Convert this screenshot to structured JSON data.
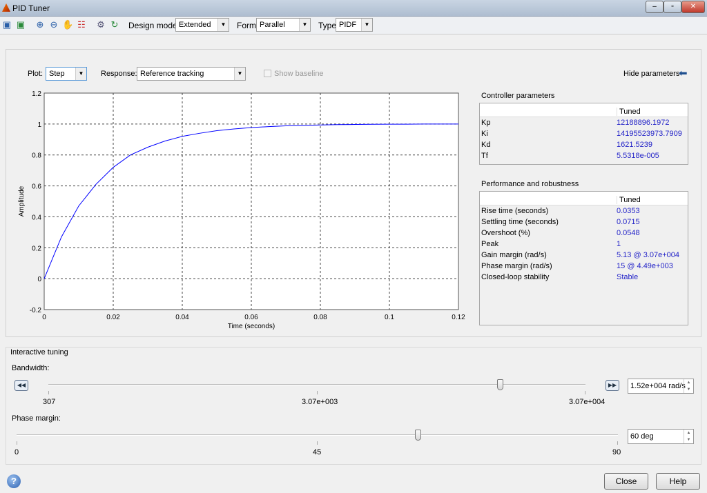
{
  "window": {
    "title": "PID Tuner"
  },
  "toolbar": {
    "icons": [
      "import-plant-icon",
      "export-icon",
      "zoom-in-icon",
      "zoom-out-icon",
      "pan-icon",
      "legend-icon",
      "options-icon",
      "reset-icon"
    ],
    "design_mode_label": "Design mode:",
    "design_mode_value": "Extended",
    "form_label": "Form",
    "form_value": "Parallel",
    "type_label": "Type",
    "type_value": "PIDF"
  },
  "plot_controls": {
    "plot_label": "Plot:",
    "plot_value": "Step",
    "response_label": "Response:",
    "response_value": "Reference tracking",
    "show_baseline": "Show baseline",
    "hide_parameters": "Hide parameters"
  },
  "chart_data": {
    "type": "line",
    "xlabel": "Time (seconds)",
    "ylabel": "Amplitude",
    "xlim": [
      0,
      0.12
    ],
    "ylim": [
      -0.2,
      1.2
    ],
    "grid": true,
    "xticks": [
      "0",
      "0.02",
      "0.04",
      "0.06",
      "0.08",
      "0.1",
      "0.12"
    ],
    "yticks": [
      "-0.2",
      "0",
      "0.2",
      "0.4",
      "0.6",
      "0.8",
      "1",
      "1.2"
    ],
    "series": [
      {
        "color": "#0000ff",
        "x": [
          0,
          0.005,
          0.01,
          0.015,
          0.02,
          0.025,
          0.03,
          0.035,
          0.04,
          0.045,
          0.05,
          0.055,
          0.06,
          0.065,
          0.07,
          0.075,
          0.08,
          0.085,
          0.09,
          0.095,
          0.1,
          0.105,
          0.11,
          0.115,
          0.12
        ],
        "y": [
          0,
          0.27,
          0.47,
          0.61,
          0.72,
          0.8,
          0.85,
          0.89,
          0.92,
          0.94,
          0.957,
          0.968,
          0.977,
          0.983,
          0.988,
          0.991,
          0.994,
          0.996,
          0.997,
          0.998,
          0.999,
          0.999,
          1,
          1,
          1
        ]
      }
    ]
  },
  "controller": {
    "title": "Controller parameters",
    "col": "Tuned",
    "rows": [
      {
        "name": "Kp",
        "value": "12188896.1972"
      },
      {
        "name": "Ki",
        "value": "14195523973.7909"
      },
      {
        "name": "Kd",
        "value": "1621.5239"
      },
      {
        "name": "Tf",
        "value": "5.5318e-005"
      }
    ]
  },
  "performance": {
    "title": "Performance and robustness",
    "col": "Tuned",
    "rows": [
      {
        "name": "Rise time (seconds)",
        "value": "0.0353"
      },
      {
        "name": "Settling time (seconds)",
        "value": "0.0715"
      },
      {
        "name": "Overshoot (%)",
        "value": "0.0548"
      },
      {
        "name": "Peak",
        "value": "1"
      },
      {
        "name": "Gain margin (rad/s)",
        "value": "5.13 @ 3.07e+004"
      },
      {
        "name": "Phase margin (rad/s)",
        "value": "15 @ 4.49e+003"
      },
      {
        "name": "Closed-loop stability",
        "value": "Stable"
      }
    ]
  },
  "tuning": {
    "title": "Interactive tuning",
    "bandwidth": {
      "label": "Bandwidth:",
      "value": "1.52e+004 rad/s",
      "ticks": [
        "307",
        "3.07e+003",
        "3.07e+004"
      ],
      "position": 0.84
    },
    "phase": {
      "label": "Phase margin:",
      "value": "60 deg",
      "ticks": [
        "0",
        "45",
        "90"
      ],
      "position": 0.667
    }
  },
  "footer": {
    "close": "Close",
    "help": "Help"
  }
}
